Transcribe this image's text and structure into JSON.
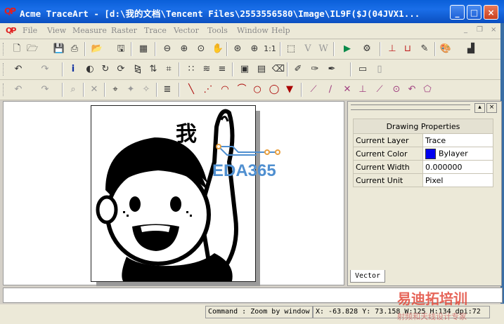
{
  "window": {
    "logo_text": "QP",
    "title": "Acme TraceArt - [d:\\我的文档\\Tencent Files\\2553556580\\Image\\IL9F($J(04JVX1...",
    "minimize": "_",
    "maximize": "□",
    "close": "×"
  },
  "menu": {
    "logo_text": "QP",
    "items": [
      "File",
      "View",
      "Measure",
      "Raster",
      "Trace",
      "Vector",
      "Tools",
      "Window",
      "Help"
    ],
    "mdi_min": "_",
    "mdi_restore": "❐",
    "mdi_close": "×"
  },
  "toolbar1": {
    "zoom_one": "1:1",
    "vector_v": "V",
    "vector_w": "W"
  },
  "panel": {
    "pin": "▴",
    "close": "×",
    "header": "Drawing Properties",
    "rows": [
      {
        "key": "Current Layer",
        "value": "Trace"
      },
      {
        "key": "Current Color",
        "value": "Bylayer"
      },
      {
        "key": "Current Width",
        "value": "0.000000"
      },
      {
        "key": "Current Unit",
        "value": "Pixel"
      }
    ],
    "tab": "Vector"
  },
  "colors": {
    "current_color_swatch": "#0000f0"
  },
  "canvas": {
    "image_text": "我"
  },
  "status": {
    "command": "Command : Zoom by window",
    "coords": "X: -63.828 Y: 73.158 W:125 H:134 dpi:72"
  },
  "watermarks": {
    "eda": "EDA365",
    "cn": "易迪拓培训",
    "cn_sub": "射频和天线设计专家"
  }
}
